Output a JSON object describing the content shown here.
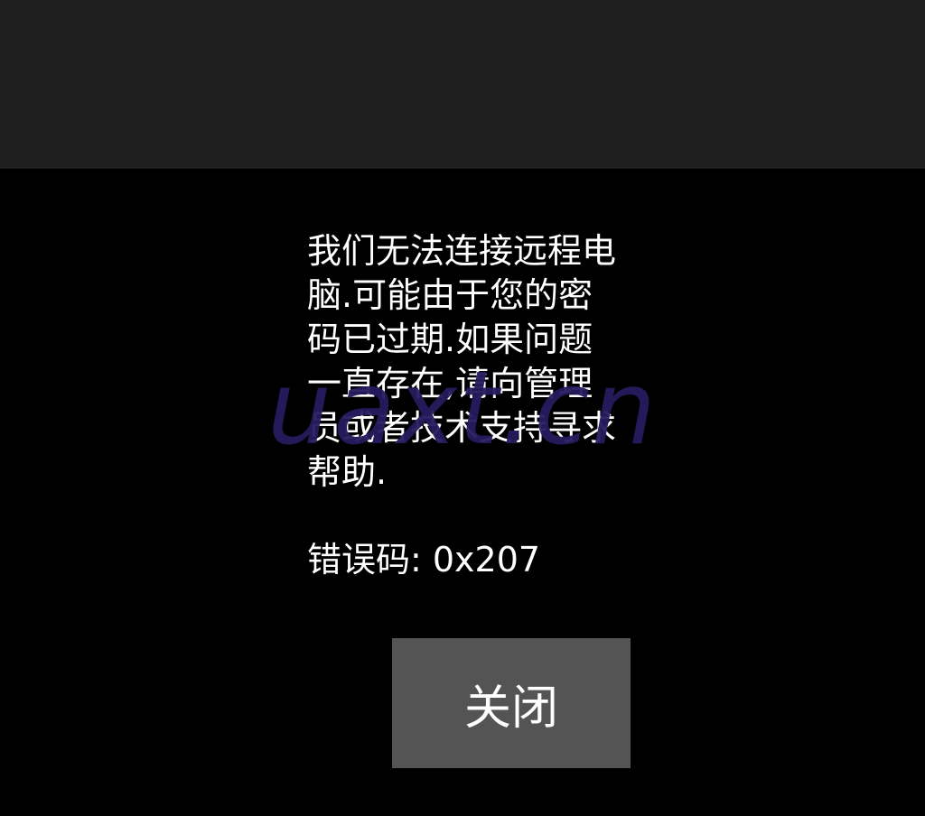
{
  "dialog": {
    "message": "我们无法连接远程电脑.可能由于您的密码已过期.如果问题一直存在,请向管理员或者技术支持寻求帮助.",
    "error_code": "错误码: 0x207",
    "close_label": "关闭"
  },
  "watermark": {
    "text": "uaxt.cn"
  },
  "colors": {
    "top_bar": "#1f1f1f",
    "background": "#000000",
    "button": "#545454",
    "text": "#ffffff",
    "watermark": "#261c5e"
  }
}
